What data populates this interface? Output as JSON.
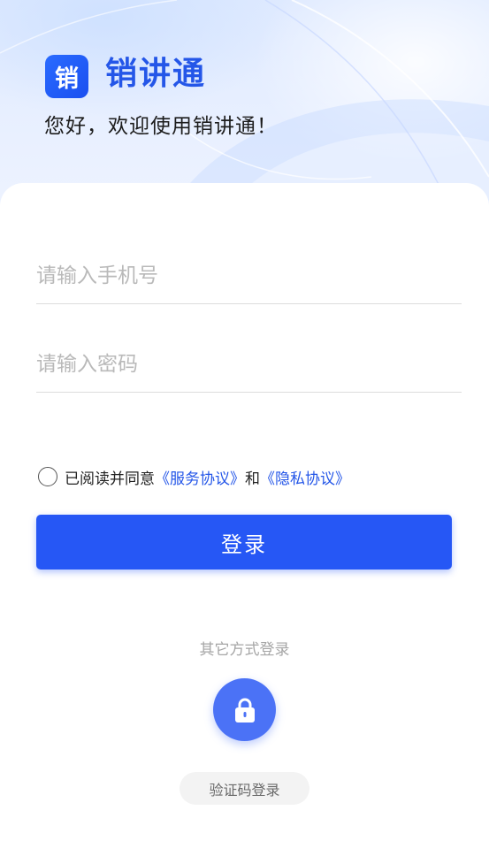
{
  "header": {
    "logo_text": "销",
    "app_name": "销讲通",
    "welcome": "您好，欢迎使用销讲通！"
  },
  "form": {
    "phone_placeholder": "请输入手机号",
    "password_placeholder": "请输入密码"
  },
  "agreement": {
    "prefix": "已阅读并同意",
    "service_link": "《服务协议》",
    "and": "和",
    "privacy_link": "《隐私协议》",
    "checked": false
  },
  "login_button": "登录",
  "other_login": {
    "title": "其它方式登录",
    "lock_icon": "lock-icon",
    "code_login": "验证码登录"
  },
  "colors": {
    "accent": "#2657f5",
    "brand_text": "#2456e8",
    "lock_button": "#4b72f6"
  }
}
